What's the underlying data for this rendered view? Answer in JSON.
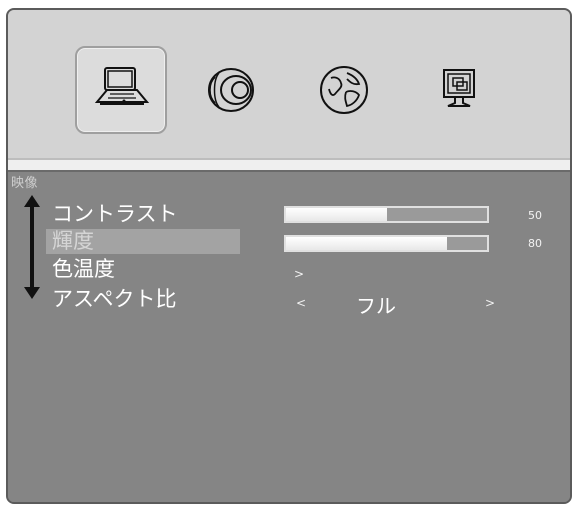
{
  "tabs": [
    {
      "icon": "laptop-icon",
      "selected": true
    },
    {
      "icon": "speaker-icon",
      "selected": false
    },
    {
      "icon": "globe-icon",
      "selected": false
    },
    {
      "icon": "monitor-icon",
      "selected": false
    }
  ],
  "section": {
    "title": "映像"
  },
  "items": [
    {
      "label": "コントラスト",
      "type": "slider",
      "value": "50",
      "fill_fraction": 0.5
    },
    {
      "label": "輝度",
      "type": "slider",
      "value": "80",
      "fill_fraction": 0.8,
      "selected": true
    },
    {
      "label": "色温度",
      "type": "submenu",
      "arrow": ">"
    },
    {
      "label": "アスペクト比",
      "type": "selector",
      "left_arrow": "<",
      "value": "フル",
      "right_arrow": ">"
    }
  ],
  "colors": {
    "panel_bg": "#858585",
    "header_bg": "#d3d3d3",
    "selected_row": "#a3a3a3",
    "text": "#ffffff"
  }
}
